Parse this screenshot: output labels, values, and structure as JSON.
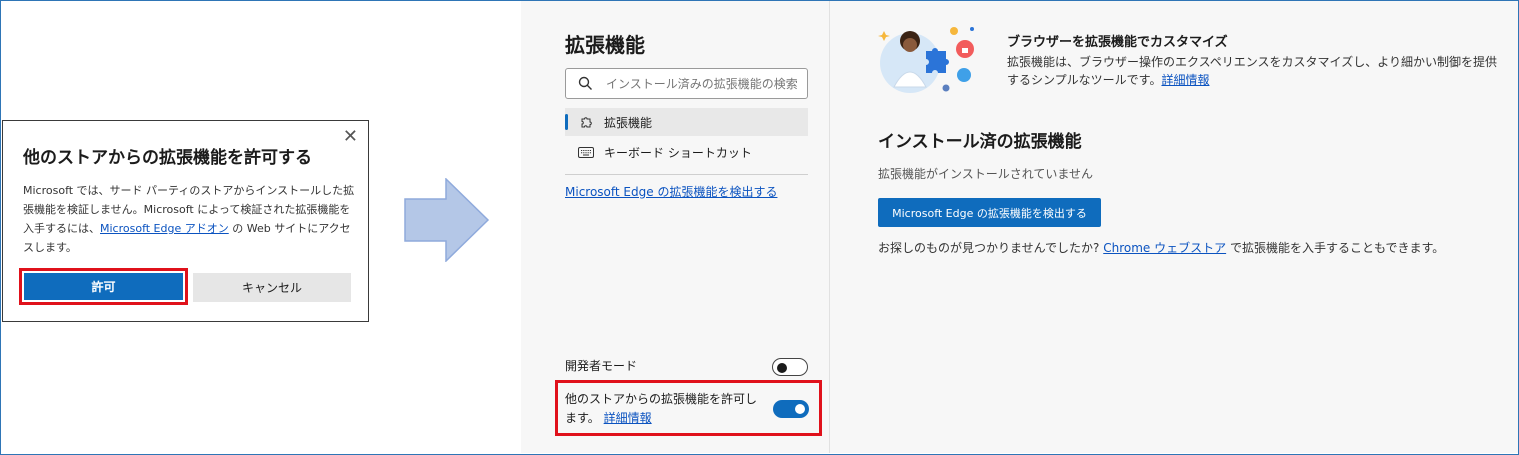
{
  "dialog": {
    "title": "他のストアからの拡張機能を許可する",
    "body_before_link": "Microsoft では、サード パーティのストアからインストールした拡張機能を検証しません。Microsoft によって検証された拡張機能を入手するには、",
    "body_link": "Microsoft Edge アドオン",
    "body_after_link": " の Web サイトにアクセスします。",
    "allow_label": "許可",
    "cancel_label": "キャンセル",
    "close_glyph": "✕"
  },
  "sidebar": {
    "title": "拡張機能",
    "search_placeholder": "インストール済みの拡張機能の検索",
    "nav": [
      {
        "label": "拡張機能",
        "icon": "puzzle-icon",
        "active": true
      },
      {
        "label": "キーボード ショートカット",
        "icon": "keyboard-icon",
        "active": false
      }
    ],
    "discover_link": "Microsoft Edge の拡張機能を検出する",
    "developer_mode_label": "開発者モード",
    "developer_mode_on": false,
    "other_store_label": "他のストアからの拡張機能を許可します。",
    "other_store_link": "詳細情報",
    "other_store_on": true
  },
  "main": {
    "hero_title": "ブラウザーを拡張機能でカスタマイズ",
    "hero_desc": "拡張機能は、ブラウザー操作のエクスペリエンスをカスタマイズし、より細かい制御を提供するシンプルなツールです。",
    "hero_link": "詳細情報",
    "installed_title": "インストール済の拡張機能",
    "none_installed": "拡張機能がインストールされていません",
    "discover_button": "Microsoft Edge の拡張機能を検出する",
    "find_before": "お探しのものが見つかりませんでしたか? ",
    "find_link": "Chrome ウェブストア",
    "find_after": " で拡張機能を入手することもできます。"
  },
  "colors": {
    "accent": "#0f6cbd",
    "highlight_border": "#e0111b",
    "link": "#0b53c0",
    "arrow_fill": "#b4c7e7",
    "arrow_stroke": "#8faadc"
  }
}
